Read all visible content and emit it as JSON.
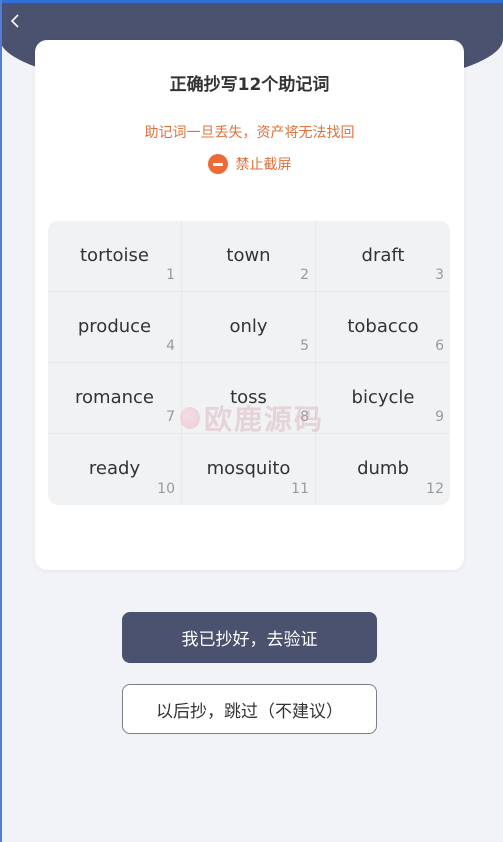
{
  "header": {
    "back_icon": "chevron-left-icon"
  },
  "card": {
    "title": "正确抄写12个助记词",
    "warning": "助记词一旦丢失，资产将无法找回",
    "no_screenshot_label": "禁止截屏",
    "no_screenshot_icon": "minus-circle-icon"
  },
  "words": [
    {
      "word": "tortoise",
      "index": "1"
    },
    {
      "word": "town",
      "index": "2"
    },
    {
      "word": "draft",
      "index": "3"
    },
    {
      "word": "produce",
      "index": "4"
    },
    {
      "word": "only",
      "index": "5"
    },
    {
      "word": "tobacco",
      "index": "6"
    },
    {
      "word": "romance",
      "index": "7"
    },
    {
      "word": "toss",
      "index": "8"
    },
    {
      "word": "bicycle",
      "index": "9"
    },
    {
      "word": "ready",
      "index": "10"
    },
    {
      "word": "mosquito",
      "index": "11"
    },
    {
      "word": "dumb",
      "index": "12"
    }
  ],
  "watermark": {
    "text": "欧鹿源码"
  },
  "actions": {
    "confirm_label": "我已抄好，去验证",
    "skip_label": "以后抄，跳过（不建议）"
  },
  "colors": {
    "header": "#4a5270",
    "warning": "#e0703a",
    "icon_orange": "#ec6a35",
    "page_bg": "#f2f3f6"
  }
}
